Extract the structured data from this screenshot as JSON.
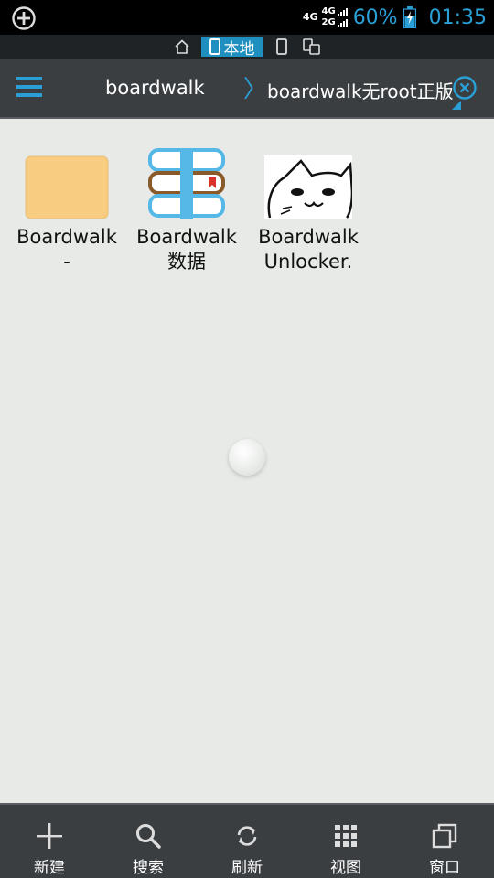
{
  "status": {
    "net_top": "4G",
    "net_bottom": "2G",
    "net_side": "4G",
    "battery": "60%",
    "time": "01:35"
  },
  "location_bar": {
    "local_label": "本地"
  },
  "toolbar": {
    "title": "boardwalk",
    "breadcrumb": "boardwalk无root正版"
  },
  "files": [
    {
      "name_line1": "Boardwalk",
      "name_line2": "-",
      "icon": "folder-icon"
    },
    {
      "name_line1": "Boardwalk",
      "name_line2": "数据",
      "icon": "books-icon"
    },
    {
      "name_line1": "Boardwalk",
      "name_line2": "Unlocker.",
      "icon": "cat-image-icon"
    }
  ],
  "bottom_bar": {
    "new_label": "新建",
    "search_label": "搜索",
    "refresh_label": "刷新",
    "view_label": "视图",
    "window_label": "窗口"
  },
  "colors": {
    "accent": "#2a9fd6",
    "toolbar_bg": "#3b3e41",
    "content_bg": "#e7eae6",
    "folder": "#f8cd82"
  }
}
